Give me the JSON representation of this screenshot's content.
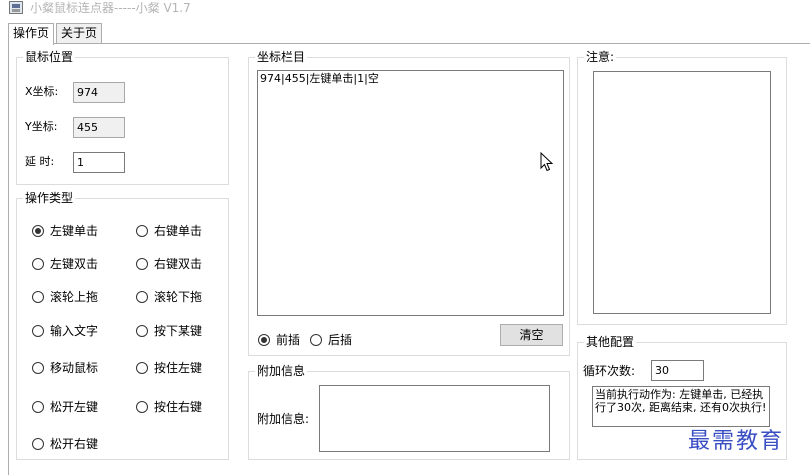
{
  "window": {
    "title": "小粲鼠标连点器-----小粲 V1.7",
    "icon": "app-window-icon"
  },
  "tabs": [
    {
      "label": "操作页",
      "active": true
    },
    {
      "label": "关于页",
      "active": false
    }
  ],
  "mouse_position": {
    "title": "鼠标位置",
    "x_label": "X坐标:",
    "x_value": "974",
    "y_label": "Y坐标:",
    "y_value": "455",
    "delay_label": "延 时:",
    "delay_value": "1"
  },
  "operation_type": {
    "title": "操作类型",
    "options": [
      {
        "label": "左键单击",
        "selected": true
      },
      {
        "label": "右键单击",
        "selected": false
      },
      {
        "label": "左键双击",
        "selected": false
      },
      {
        "label": "右键双击",
        "selected": false
      },
      {
        "label": "滚轮上拖",
        "selected": false
      },
      {
        "label": "滚轮下拖",
        "selected": false
      },
      {
        "label": "输入文字",
        "selected": false
      },
      {
        "label": "按下某键",
        "selected": false
      },
      {
        "label": "移动鼠标",
        "selected": false
      },
      {
        "label": "按住左键",
        "selected": false
      },
      {
        "label": "松开左键",
        "selected": false
      },
      {
        "label": "按住右键",
        "selected": false
      },
      {
        "label": "松开右键",
        "selected": false
      }
    ]
  },
  "coordinate_list": {
    "title": "坐标栏目",
    "items": [
      "974|455|左键单击|1|空"
    ],
    "insert_front_label": "前插",
    "insert_front_selected": true,
    "insert_back_label": "后插",
    "insert_back_selected": false,
    "clear_label": "清空"
  },
  "extra_info": {
    "title": "附加信息",
    "label": "附加信息:",
    "value": ""
  },
  "notes": {
    "title": "注意:",
    "content": ""
  },
  "other_config": {
    "title": "其他配置",
    "loop_label": "循环次数:",
    "loop_value": "30",
    "status_text": "当前执行动作为: 左键单击, 已经执行了30次, 距离结束, 还有0次执行!"
  },
  "watermark": {
    "text": "最需教育"
  }
}
